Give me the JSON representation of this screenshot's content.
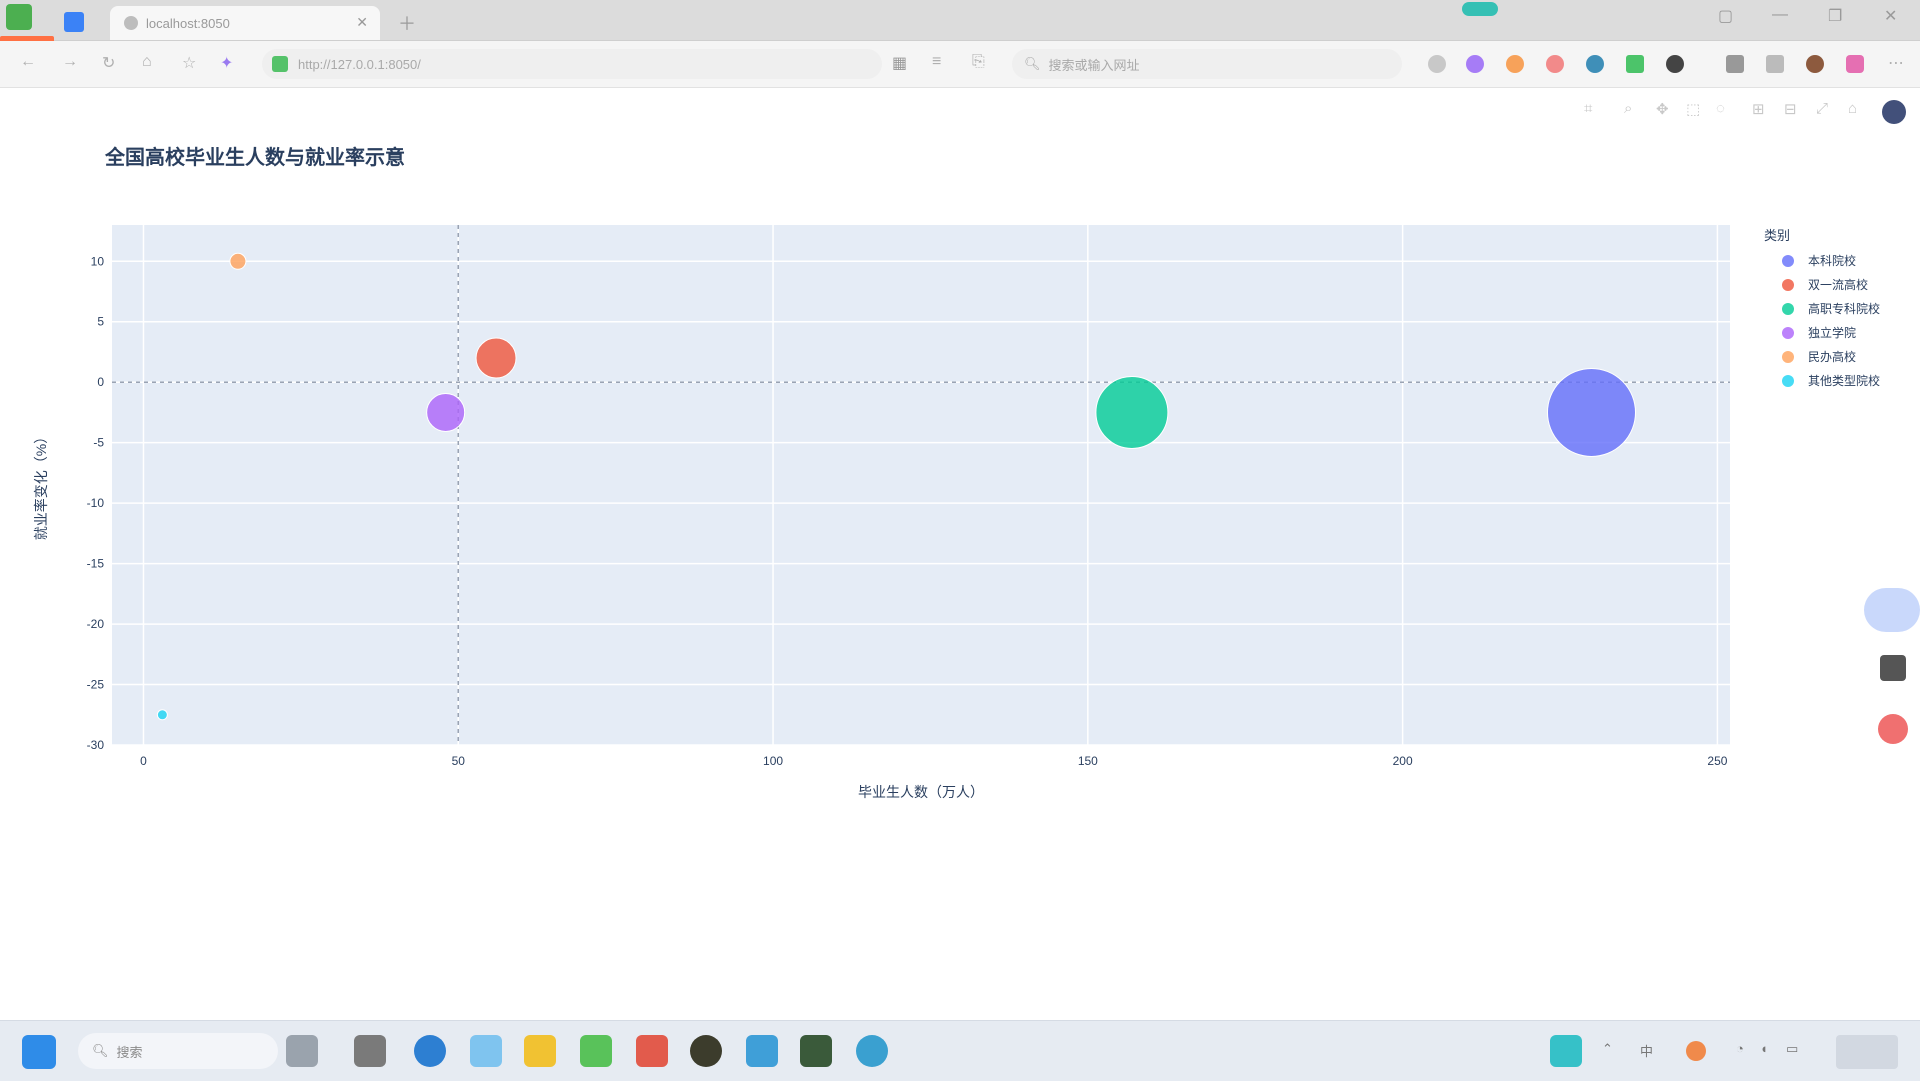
{
  "browser": {
    "tab_title": "localhost:8050",
    "url": "http://127.0.0.1:8050/",
    "search_placeholder": "搜索或输入网址"
  },
  "taskbar": {
    "search_label": "搜索"
  },
  "chart_data": {
    "type": "scatter",
    "title": "全国高校毕业生人数与就业率示意",
    "xlabel": "毕业生人数（万人）",
    "ylabel": "就业率变化（%）",
    "legend_title": "类别",
    "legend_position": "top-right",
    "grid": true,
    "xlim": [
      -5,
      252
    ],
    "ylim": [
      -30,
      13
    ],
    "x_ticks": [
      0,
      50,
      100,
      150,
      200,
      250
    ],
    "y_ticks": [
      10,
      5,
      0,
      -5,
      -10,
      -15,
      -20,
      -25,
      -30
    ],
    "reference_lines": {
      "x": 50,
      "y": 0
    },
    "series": [
      {
        "name": "本科院校",
        "x": 230,
        "y": -2.5,
        "size": 88,
        "color": "#636efa"
      },
      {
        "name": "双一流高校",
        "x": 56,
        "y": 2,
        "size": 40,
        "color": "#ef553b"
      },
      {
        "name": "高职专科院校",
        "x": 157,
        "y": -2.5,
        "size": 72,
        "color": "#00cc96"
      },
      {
        "name": "独立学院",
        "x": 48,
        "y": -2.5,
        "size": 38,
        "color": "#ab63fa"
      },
      {
        "name": "民办高校",
        "x": 15,
        "y": 10,
        "size": 16,
        "color": "#ffa15a"
      },
      {
        "name": "其他类型院校",
        "x": 3,
        "y": -27.5,
        "size": 10,
        "color": "#19d3f3"
      }
    ]
  }
}
